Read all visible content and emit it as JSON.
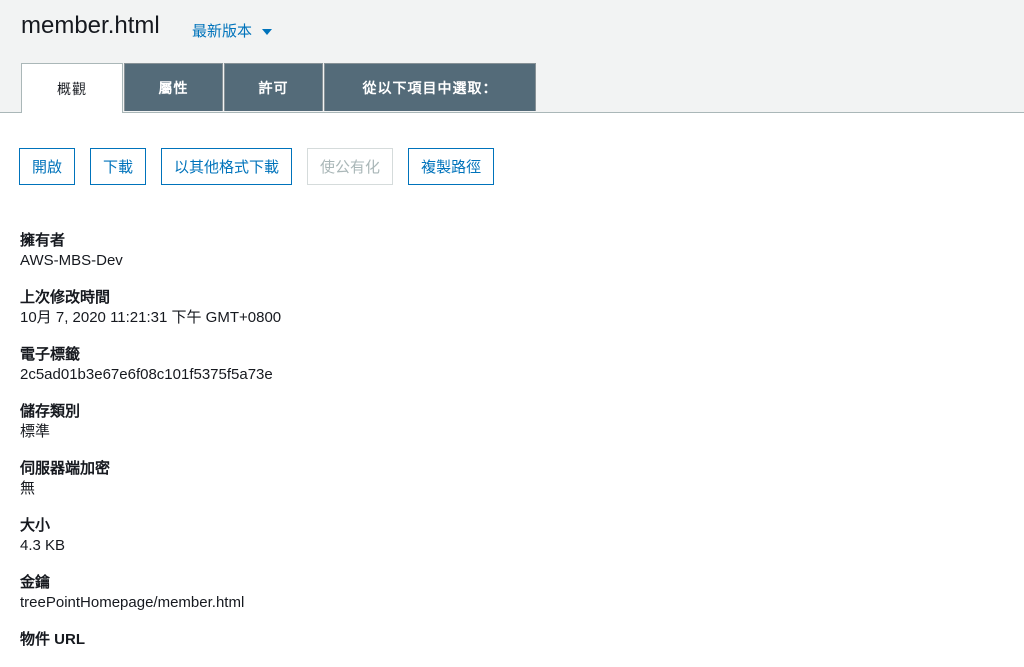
{
  "header": {
    "title": "member.html",
    "version_label": "最新版本"
  },
  "tabs": [
    {
      "label": "概觀"
    },
    {
      "label": "屬性"
    },
    {
      "label": "許可"
    },
    {
      "label": "從以下項目中選取："
    }
  ],
  "actions": {
    "open": "開啟",
    "download": "下載",
    "download_as": "以其他格式下載",
    "make_public": "使公有化",
    "copy_path": "複製路徑"
  },
  "details": [
    {
      "label": "擁有者",
      "value": "AWS-MBS-Dev"
    },
    {
      "label": "上次修改時間",
      "value": "10月 7, 2020 11:21:31 下午 GMT+0800"
    },
    {
      "label": "電子標籤",
      "value": "2c5ad01b3e67e6f08c101f5375f5a73e"
    },
    {
      "label": "儲存類別",
      "value": "標準"
    },
    {
      "label": "伺服器端加密",
      "value": "無"
    },
    {
      "label": "大小",
      "value": "4.3 KB"
    },
    {
      "label": "金鑰",
      "value": "treePointHomepage/member.html"
    },
    {
      "label": "物件 URL",
      "value": ""
    }
  ],
  "colors": {
    "link": "#0073bb",
    "tab_inactive": "#546b79",
    "header_bg": "#f2f3f3"
  }
}
